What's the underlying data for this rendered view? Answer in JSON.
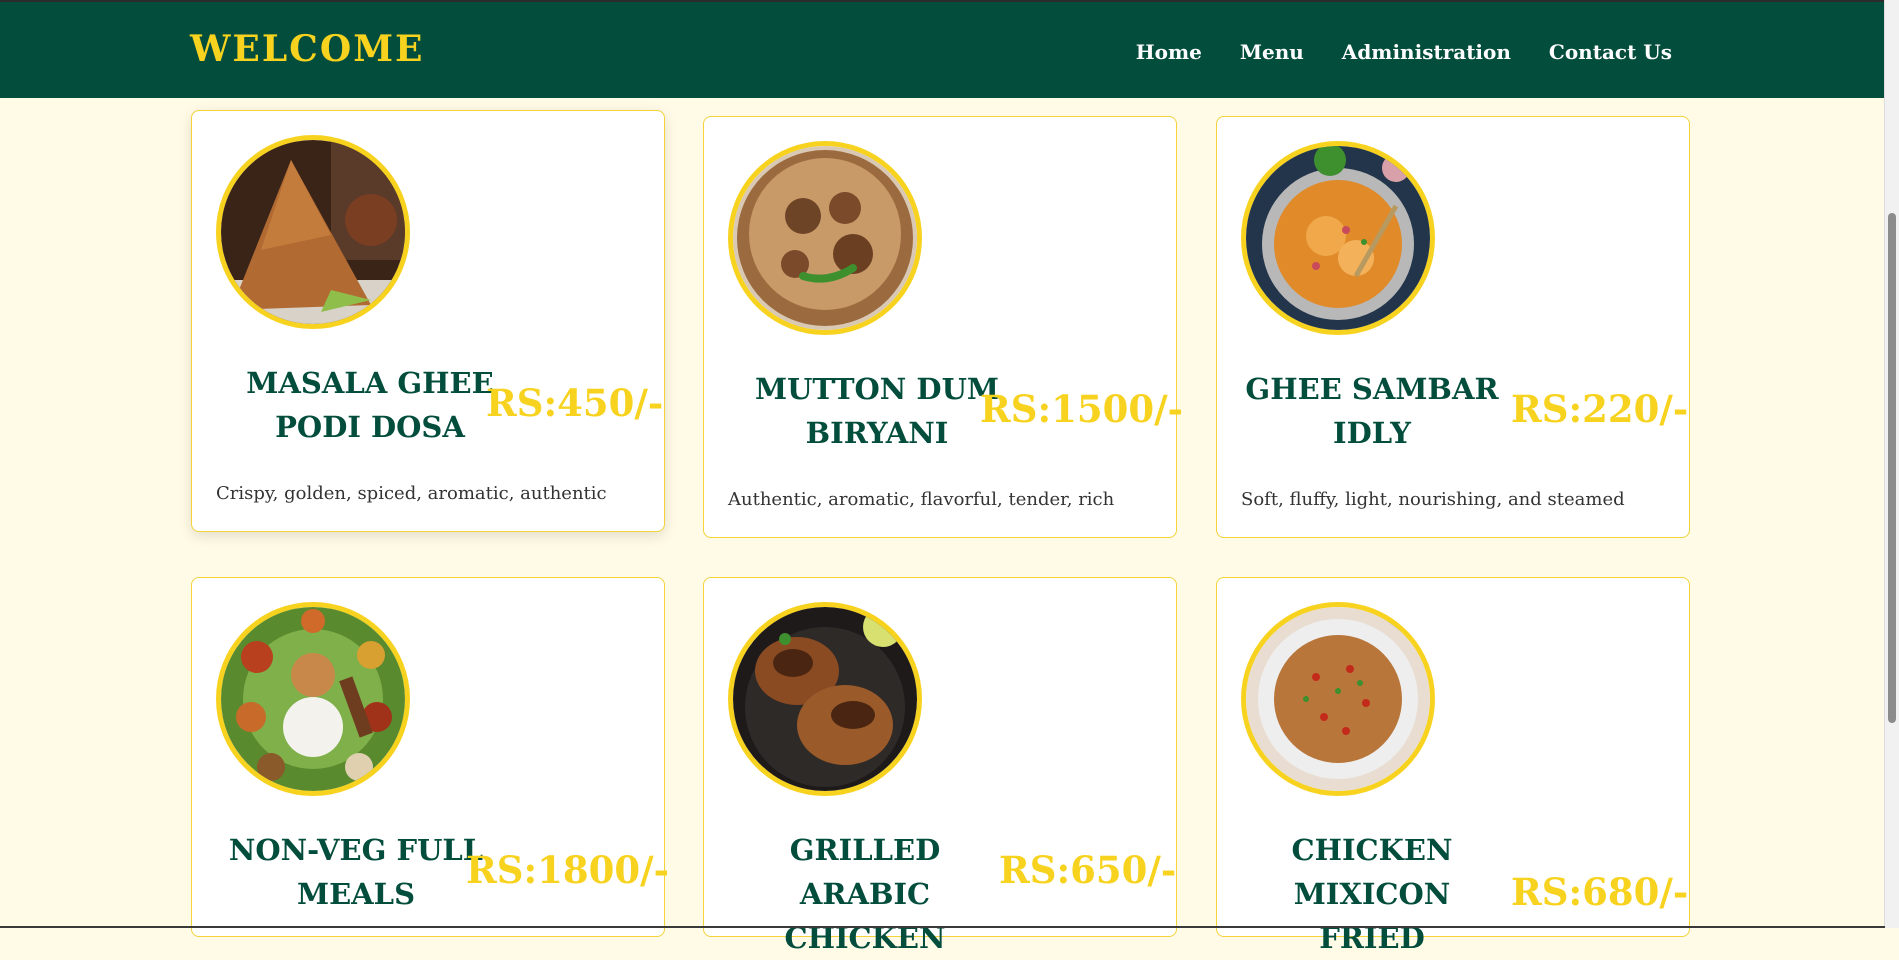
{
  "header": {
    "brand": "WELCOME",
    "nav": [
      "Home",
      "Menu",
      "Administration",
      "Contact Us"
    ]
  },
  "colors": {
    "header_bg": "#034d3c",
    "accent": "#f7d21e",
    "page_bg": "#fffbe6"
  },
  "menu": {
    "items": [
      {
        "name": "MASALA GHEE PODI DOSA",
        "price": "RS:450/-",
        "description": "Crispy, golden, spiced, aromatic, authentic",
        "image": "dosa"
      },
      {
        "name": "MUTTON DUM BIRYANI",
        "price": "RS:1500/-",
        "description": "Authentic, aromatic, flavorful, tender, rich",
        "image": "biryani"
      },
      {
        "name": "GHEE SAMBAR IDLY",
        "price": "RS:220/-",
        "description": "Soft, fluffy, light, nourishing, and steamed",
        "image": "idly"
      },
      {
        "name": "NON-VEG FULL MEALS",
        "price": "RS:1800/-",
        "description": "",
        "image": "meals"
      },
      {
        "name": "GRILLED ARABIC CHICKEN",
        "price": "RS:650/-",
        "description": "",
        "image": "chicken"
      },
      {
        "name": "CHICKEN MIXICON FRIED",
        "price": "RS:680/-",
        "description": "",
        "image": "rice"
      }
    ]
  }
}
